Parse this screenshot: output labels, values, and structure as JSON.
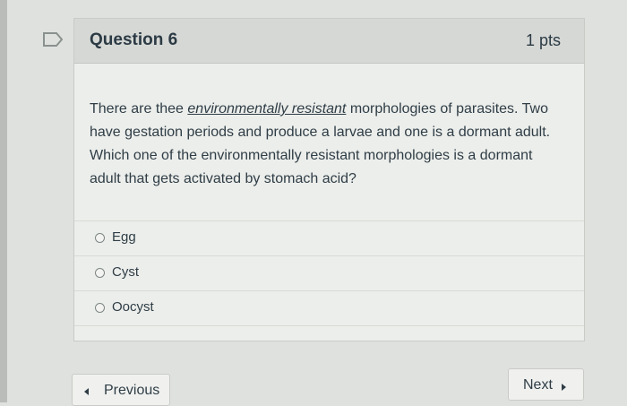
{
  "question": {
    "title": "Question 6",
    "points": "1 pts",
    "text_before": "There are thee ",
    "text_underlined": "environmentally resistant",
    "text_after": " morphologies of parasites. Two have gestation periods and produce a larvae and one is a dormant adult. Which one of the environmentally resistant morphologies is a dormant adult that gets activated by stomach acid?"
  },
  "answers": [
    {
      "label": "Egg"
    },
    {
      "label": "Cyst"
    },
    {
      "label": "Oocyst"
    }
  ],
  "navigation": {
    "previous_label": "Previous",
    "next_label": "Next"
  },
  "icons": {
    "flag": "flag-outline-icon",
    "previous": "chevron-left-icon",
    "next": "chevron-right-icon"
  }
}
